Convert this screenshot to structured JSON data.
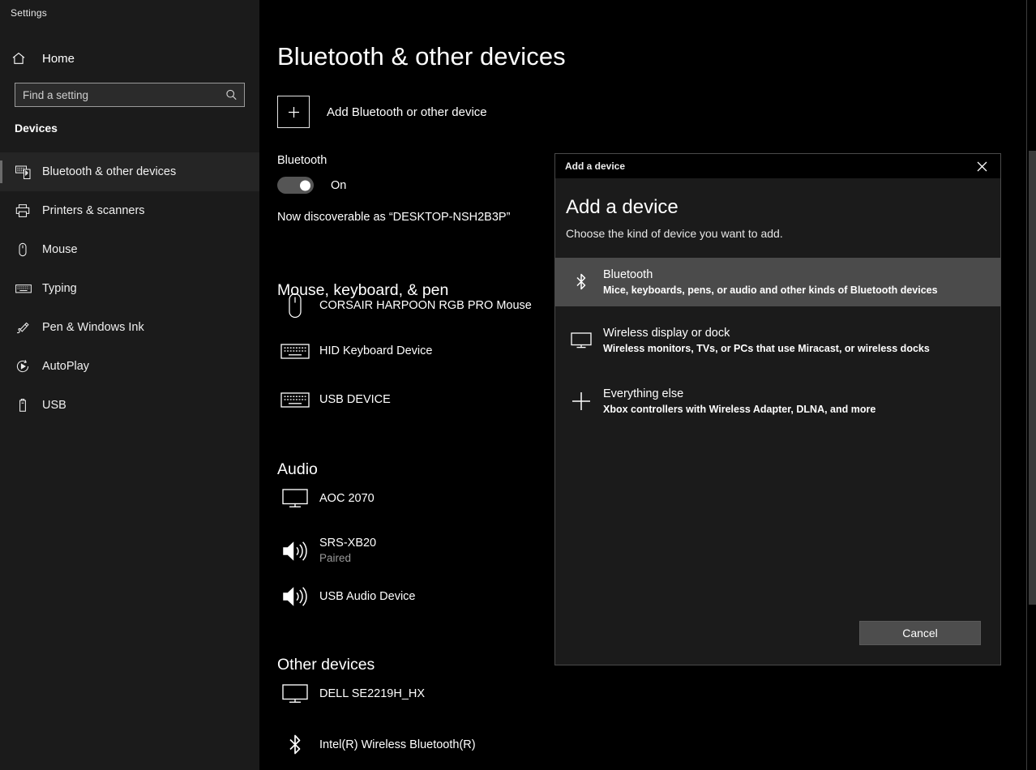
{
  "window": {
    "app_title": "Settings"
  },
  "sidebar": {
    "home_label": "Home",
    "home_icon": "home-icon",
    "search": {
      "placeholder": "Find a setting",
      "value": "",
      "icon": "search-icon"
    },
    "section_header": "Devices",
    "items": [
      {
        "label": "Bluetooth & other devices",
        "icon": "bluetooth-devices-icon",
        "active": true
      },
      {
        "label": "Printers & scanners",
        "icon": "printer-icon",
        "active": false
      },
      {
        "label": "Mouse",
        "icon": "mouse-icon",
        "active": false
      },
      {
        "label": "Typing",
        "icon": "keyboard-icon",
        "active": false
      },
      {
        "label": "Pen & Windows Ink",
        "icon": "pen-icon",
        "active": false
      },
      {
        "label": "AutoPlay",
        "icon": "autoplay-icon",
        "active": false
      },
      {
        "label": "USB",
        "icon": "usb-icon",
        "active": false
      }
    ]
  },
  "main": {
    "page_title": "Bluetooth & other devices",
    "add_device": {
      "label": "Add Bluetooth or other device",
      "icon": "plus-icon"
    },
    "bluetooth": {
      "label": "Bluetooth",
      "toggle_state": "On",
      "toggle_on": true,
      "discoverable_text": "Now discoverable as “DESKTOP-NSH2B3P”"
    },
    "groups": [
      {
        "header": "Mouse, keyboard, & pen",
        "devices": [
          {
            "name": "CORSAIR HARPOON RGB PRO Mouse",
            "status": "",
            "icon": "mouse-icon"
          },
          {
            "name": "HID Keyboard Device",
            "status": "",
            "icon": "keyboard-icon"
          },
          {
            "name": "USB DEVICE",
            "status": "",
            "icon": "keyboard-icon"
          }
        ]
      },
      {
        "header": "Audio",
        "devices": [
          {
            "name": "AOC 2070",
            "status": "",
            "icon": "monitor-icon"
          },
          {
            "name": "SRS-XB20",
            "status": "Paired",
            "icon": "speaker-icon"
          },
          {
            "name": "USB Audio Device",
            "status": "",
            "icon": "speaker-icon"
          }
        ]
      },
      {
        "header": "Other devices",
        "devices": [
          {
            "name": "DELL SE2219H_HX",
            "status": "",
            "icon": "monitor-icon"
          },
          {
            "name": "Intel(R) Wireless Bluetooth(R)",
            "status": "",
            "icon": "bluetooth-icon"
          }
        ]
      }
    ]
  },
  "dialog": {
    "titlebar_title": "Add a device",
    "close_icon": "close-icon",
    "heading": "Add a device",
    "subtitle": "Choose the kind of device you want to add.",
    "choices": [
      {
        "title": "Bluetooth",
        "description": "Mice, keyboards, pens, or audio and other kinds of Bluetooth devices",
        "icon": "bluetooth-icon",
        "selected": true
      },
      {
        "title": "Wireless display or dock",
        "description": "Wireless monitors, TVs, or PCs that use Miracast, or wireless docks",
        "icon": "monitor-icon",
        "selected": false
      },
      {
        "title": "Everything else",
        "description": "Xbox controllers with Wireless Adapter, DLNA, and more",
        "icon": "plus-icon",
        "selected": false
      }
    ],
    "cancel_label": "Cancel"
  },
  "colors": {
    "sidebar_bg": "#1b1b1b",
    "main_bg": "#000000",
    "dialog_bg": "#1b1b1b",
    "selection_bg": "#4b4b4b",
    "text_primary": "#ffffff",
    "text_secondary": "#9a9a9a"
  }
}
